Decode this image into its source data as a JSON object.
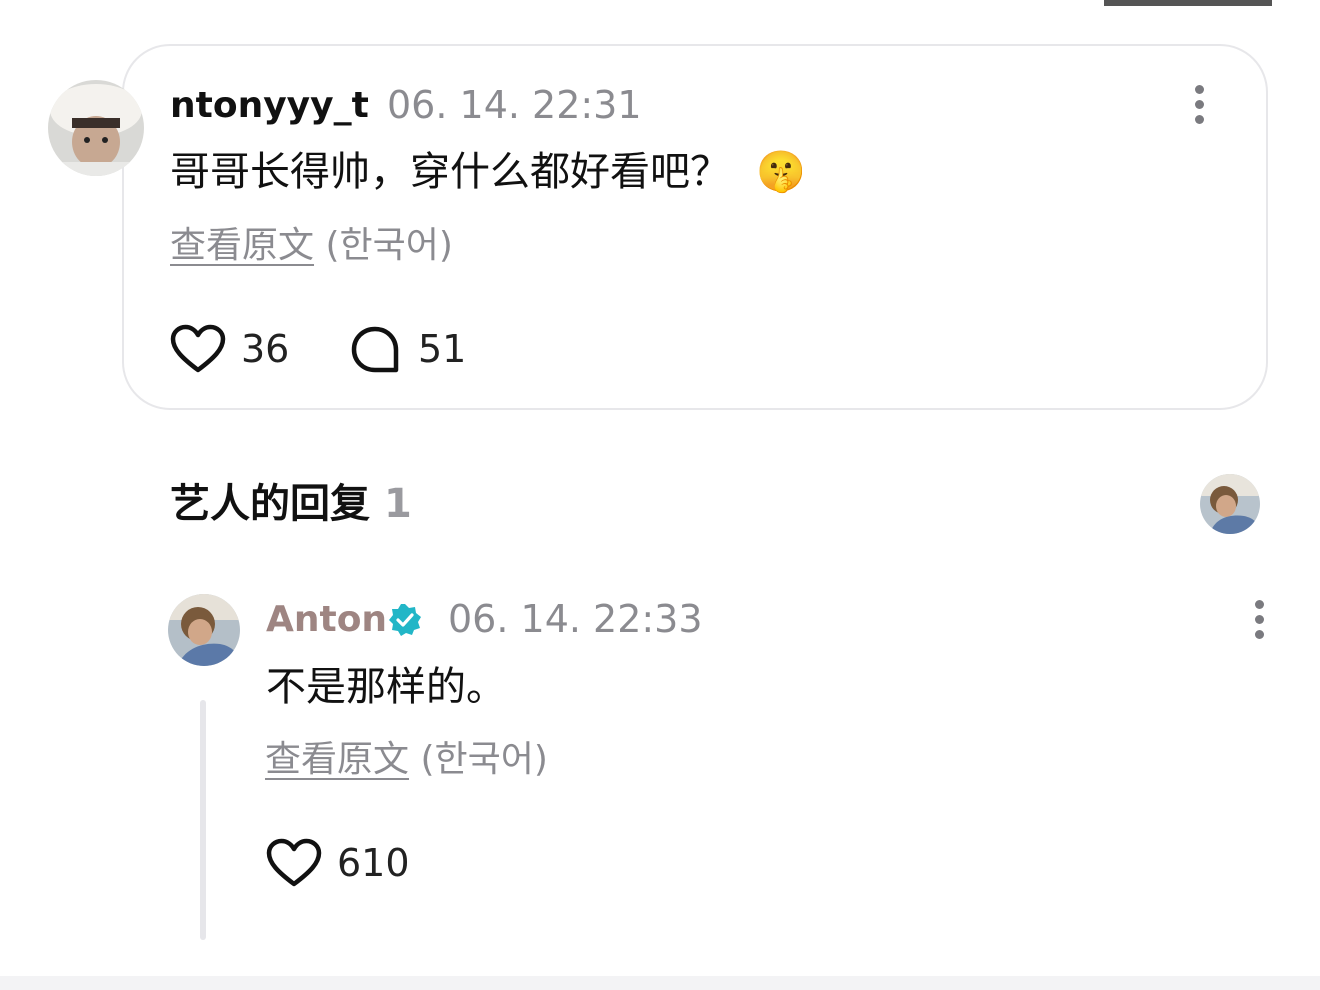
{
  "comment": {
    "username": "ntonyyy_t",
    "timestamp": "06. 14. 22:31",
    "text": "哥哥长得帅，穿什么都好看吧？",
    "emoji": "🤫",
    "translate_link": "查看原文",
    "translate_lang": " (한국어)",
    "like_count": "36",
    "reply_count": "51"
  },
  "artist_replies": {
    "title": "艺人的回复",
    "count": "1"
  },
  "reply": {
    "username": "Anton",
    "timestamp": "06. 14. 22:33",
    "text": "不是那样的。",
    "translate_link": "查看原文",
    "translate_lang": " (한국어)",
    "like_count": "610"
  },
  "colors": {
    "artist_name": "#9e8582",
    "verified_badge": "#22b6c7",
    "muted_text": "#8b8b90",
    "card_border": "#e7e7ea"
  },
  "icons": {
    "like": "heart-outline-icon",
    "reply": "speech-bubble-icon",
    "more": "more-vertical-icon",
    "verified": "verified-badge-icon"
  }
}
